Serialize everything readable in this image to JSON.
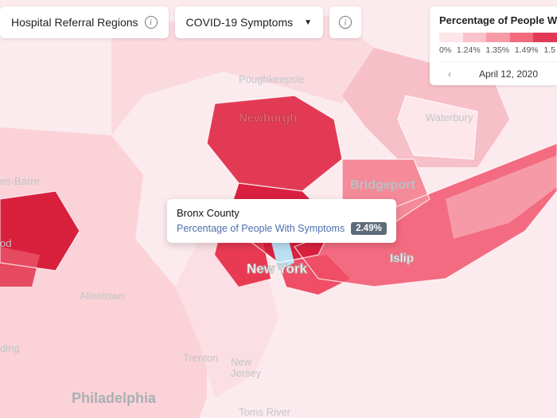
{
  "filters": {
    "region_label": "Hospital Referral Regions",
    "metric_label": "COVID-19 Symptoms"
  },
  "legend": {
    "title": "Percentage of People With S",
    "ticks": [
      "0%",
      "1.24%",
      "1.35%",
      "1.49%",
      "1.5"
    ],
    "swatch_colors": [
      "#fde5e8",
      "#fac2cb",
      "#f79aa8",
      "#f26a7c",
      "#e23a55"
    ],
    "date": "April 12, 2020"
  },
  "tooltip": {
    "region": "Bronx County",
    "metric_label": "Percentage of People With Symptoms",
    "value": "2.49%"
  },
  "city_labels": {
    "poughkeepsie": "Poughkeepsie",
    "newburgh": "Newburgh",
    "waterbury": "Waterbury",
    "bridgeport": "Bridgeport",
    "esbarre": "es-Barre",
    "od": "od",
    "allentown": "Allentown",
    "ding": "ding",
    "trenton": "Trenton",
    "newjersey": "New\nJersey",
    "philadelphia": "Philadelphia",
    "tomsriver": "Toms River",
    "newyork": "New York",
    "islip": "Islip"
  }
}
